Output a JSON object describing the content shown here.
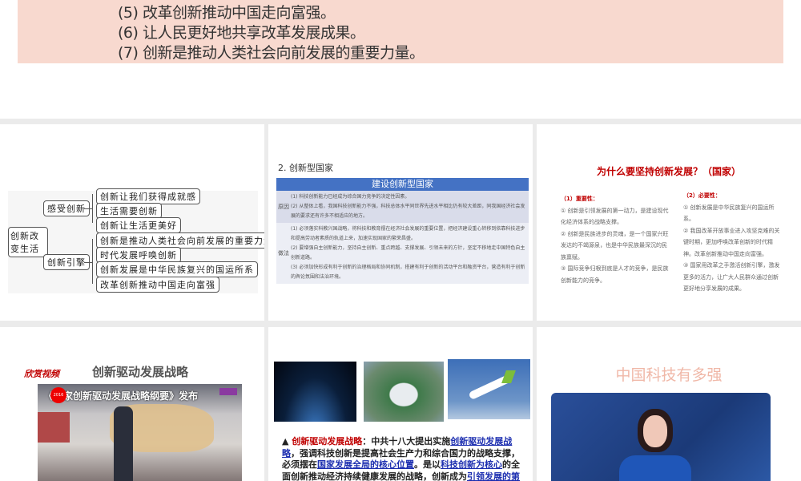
{
  "top_slide": {
    "lines": [
      "(5) 改革创新推动中国走向富强。",
      "(6) 让人民更好地共享改革发展成果。",
      "(7) 创新是推动人类社会向前发展的重要力量。"
    ]
  },
  "slide_mindmap": {
    "root": "创新改变生活",
    "branches": [
      {
        "label": "感受创新",
        "items": [
          "创新让我们获得成就感",
          "生活需要创新",
          "创新让生活更美好"
        ]
      },
      {
        "label": "创新引擎",
        "items": [
          "创新是推动人类社会向前发展的重要力量",
          "时代发展呼唤创新",
          "创新发展是中华民族复兴的国运所系",
          "改革创新推动中国走向富强"
        ]
      }
    ]
  },
  "slide_table": {
    "heading": "2. 创新型国家",
    "table_title": "建设创新型国家",
    "rows": [
      {
        "label": "原因",
        "items": [
          "(1) 科技创新能力已经成为综合国力竞争的决定性因素。",
          "(2) 从整体上看，我国科技创新能力不强，科技总体水平同世界先进水平相比仍有较大差距，同我国经济社会发展的要求还有许多不相适应的地方。"
        ]
      },
      {
        "label": "做法",
        "items": [
          "(1) 必须落实科教兴国战略，将科技和教育摆在经济社会发展的重要位置，把经济建设重心转移到依靠科技进步和提高劳动者素质的轨道上来，加速实现国家的繁荣昌盛。",
          "(2) 要增强自主创新能力，坚持自主创新、重点跨越、支撑发展、引领未来的方针，坚定不移地走中国特色自主创新道路。",
          "(3) 必须加快形成有利于创新的治理格局和协同机制，搭建有利于创新的活动平台和融资平台，营造有利于创新的舆论氛围和法治环境。"
        ]
      }
    ]
  },
  "slide_why": {
    "title": "为什么要坚持创新发展？（国家）",
    "left": {
      "heading": "（1）重要性：",
      "items": [
        "① 创新是引领发展的第一动力，是建设现代化经济体系的战略支撑。",
        "② 创新是民族进步的灵魂，是一个国家兴旺发达的不竭源泉，也是中华民族最深沉的民族禀赋。",
        "③ 国际竞争归根到底是人才的竞争，是民族创新能力的竞争。"
      ]
    },
    "right": {
      "heading": "（2）必要性：",
      "items": [
        "① 创新发展是中华民族复兴的国运所系。",
        "② 我国改革开放事业进入攻坚克难的关键时期，更加呼唤改革创新的时代精神。改革创新推动中国走向富强。",
        "③ 国家用改革之手激活创新引擎，激发更多的活力，让广大人民群众通过创新更好地分享发展的成果。"
      ]
    }
  },
  "slide_video": {
    "tag": "欣赏视频",
    "title": "创新驱动发展战略",
    "video_caption": "《国家创新驱动发展战略纲要》发布",
    "badge": "2016"
  },
  "slide_photos": {
    "lead": "▲ ",
    "term": "创新驱动发展战略",
    "p1": "：中共十八大提出实施",
    "l1": "创新驱动发展战略",
    "p2": "，强调科技创新是提高社会生产力和综合国力的战略支撑，必须摆在",
    "l2": "国家发展全局的核心位置",
    "p3": "。是以",
    "l3": "科技创新为核心",
    "p4": "的全面创新推动经济持续健康发展的战略，创新成为",
    "l4": "引领发展的第一动力"
  },
  "slide_tech": {
    "title": "中国科技有多强"
  }
}
